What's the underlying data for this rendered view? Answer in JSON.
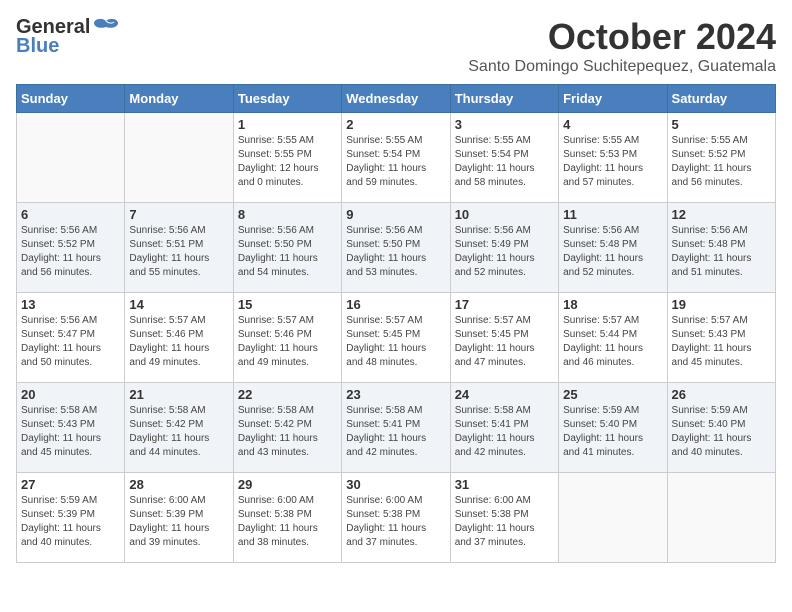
{
  "logo": {
    "general": "General",
    "blue": "Blue"
  },
  "title": "October 2024",
  "subtitle": "Santo Domingo Suchitepequez, Guatemala",
  "weekdays": [
    "Sunday",
    "Monday",
    "Tuesday",
    "Wednesday",
    "Thursday",
    "Friday",
    "Saturday"
  ],
  "weeks": [
    [
      {
        "day": "",
        "info": ""
      },
      {
        "day": "",
        "info": ""
      },
      {
        "day": "1",
        "info": "Sunrise: 5:55 AM\nSunset: 5:55 PM\nDaylight: 12 hours\nand 0 minutes."
      },
      {
        "day": "2",
        "info": "Sunrise: 5:55 AM\nSunset: 5:54 PM\nDaylight: 11 hours\nand 59 minutes."
      },
      {
        "day": "3",
        "info": "Sunrise: 5:55 AM\nSunset: 5:54 PM\nDaylight: 11 hours\nand 58 minutes."
      },
      {
        "day": "4",
        "info": "Sunrise: 5:55 AM\nSunset: 5:53 PM\nDaylight: 11 hours\nand 57 minutes."
      },
      {
        "day": "5",
        "info": "Sunrise: 5:55 AM\nSunset: 5:52 PM\nDaylight: 11 hours\nand 56 minutes."
      }
    ],
    [
      {
        "day": "6",
        "info": "Sunrise: 5:56 AM\nSunset: 5:52 PM\nDaylight: 11 hours\nand 56 minutes."
      },
      {
        "day": "7",
        "info": "Sunrise: 5:56 AM\nSunset: 5:51 PM\nDaylight: 11 hours\nand 55 minutes."
      },
      {
        "day": "8",
        "info": "Sunrise: 5:56 AM\nSunset: 5:50 PM\nDaylight: 11 hours\nand 54 minutes."
      },
      {
        "day": "9",
        "info": "Sunrise: 5:56 AM\nSunset: 5:50 PM\nDaylight: 11 hours\nand 53 minutes."
      },
      {
        "day": "10",
        "info": "Sunrise: 5:56 AM\nSunset: 5:49 PM\nDaylight: 11 hours\nand 52 minutes."
      },
      {
        "day": "11",
        "info": "Sunrise: 5:56 AM\nSunset: 5:48 PM\nDaylight: 11 hours\nand 52 minutes."
      },
      {
        "day": "12",
        "info": "Sunrise: 5:56 AM\nSunset: 5:48 PM\nDaylight: 11 hours\nand 51 minutes."
      }
    ],
    [
      {
        "day": "13",
        "info": "Sunrise: 5:56 AM\nSunset: 5:47 PM\nDaylight: 11 hours\nand 50 minutes."
      },
      {
        "day": "14",
        "info": "Sunrise: 5:57 AM\nSunset: 5:46 PM\nDaylight: 11 hours\nand 49 minutes."
      },
      {
        "day": "15",
        "info": "Sunrise: 5:57 AM\nSunset: 5:46 PM\nDaylight: 11 hours\nand 49 minutes."
      },
      {
        "day": "16",
        "info": "Sunrise: 5:57 AM\nSunset: 5:45 PM\nDaylight: 11 hours\nand 48 minutes."
      },
      {
        "day": "17",
        "info": "Sunrise: 5:57 AM\nSunset: 5:45 PM\nDaylight: 11 hours\nand 47 minutes."
      },
      {
        "day": "18",
        "info": "Sunrise: 5:57 AM\nSunset: 5:44 PM\nDaylight: 11 hours\nand 46 minutes."
      },
      {
        "day": "19",
        "info": "Sunrise: 5:57 AM\nSunset: 5:43 PM\nDaylight: 11 hours\nand 45 minutes."
      }
    ],
    [
      {
        "day": "20",
        "info": "Sunrise: 5:58 AM\nSunset: 5:43 PM\nDaylight: 11 hours\nand 45 minutes."
      },
      {
        "day": "21",
        "info": "Sunrise: 5:58 AM\nSunset: 5:42 PM\nDaylight: 11 hours\nand 44 minutes."
      },
      {
        "day": "22",
        "info": "Sunrise: 5:58 AM\nSunset: 5:42 PM\nDaylight: 11 hours\nand 43 minutes."
      },
      {
        "day": "23",
        "info": "Sunrise: 5:58 AM\nSunset: 5:41 PM\nDaylight: 11 hours\nand 42 minutes."
      },
      {
        "day": "24",
        "info": "Sunrise: 5:58 AM\nSunset: 5:41 PM\nDaylight: 11 hours\nand 42 minutes."
      },
      {
        "day": "25",
        "info": "Sunrise: 5:59 AM\nSunset: 5:40 PM\nDaylight: 11 hours\nand 41 minutes."
      },
      {
        "day": "26",
        "info": "Sunrise: 5:59 AM\nSunset: 5:40 PM\nDaylight: 11 hours\nand 40 minutes."
      }
    ],
    [
      {
        "day": "27",
        "info": "Sunrise: 5:59 AM\nSunset: 5:39 PM\nDaylight: 11 hours\nand 40 minutes."
      },
      {
        "day": "28",
        "info": "Sunrise: 6:00 AM\nSunset: 5:39 PM\nDaylight: 11 hours\nand 39 minutes."
      },
      {
        "day": "29",
        "info": "Sunrise: 6:00 AM\nSunset: 5:38 PM\nDaylight: 11 hours\nand 38 minutes."
      },
      {
        "day": "30",
        "info": "Sunrise: 6:00 AM\nSunset: 5:38 PM\nDaylight: 11 hours\nand 37 minutes."
      },
      {
        "day": "31",
        "info": "Sunrise: 6:00 AM\nSunset: 5:38 PM\nDaylight: 11 hours\nand 37 minutes."
      },
      {
        "day": "",
        "info": ""
      },
      {
        "day": "",
        "info": ""
      }
    ]
  ]
}
